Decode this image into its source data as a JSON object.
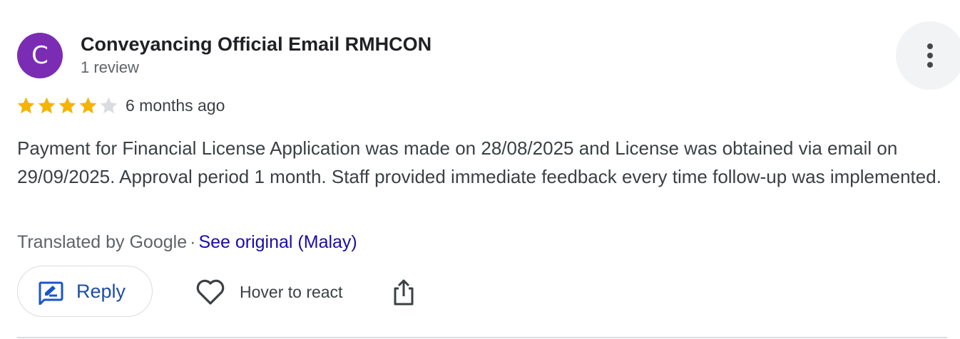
{
  "review": {
    "author": {
      "initial": "C",
      "name": "Conveyancing Official Email RMHCON",
      "review_count": "1 review",
      "avatar_color": "#7b2cb4"
    },
    "rating": 4,
    "rating_max": 5,
    "date": "6 months ago",
    "text": "Payment for Financial License Application was made on 28/08/2025 and License was obtained via email on 29/09/2025. Approval period 1 month. Staff provided immediate feedback every time follow-up was implemented.",
    "translation": {
      "note": "Translated by Google",
      "separator": "·",
      "see_original_label": "See original (Malay)"
    },
    "actions": {
      "reply_label": "Reply",
      "react_label": "Hover to react"
    }
  },
  "colors": {
    "star_filled": "#f4b400",
    "star_empty": "#dadce0",
    "link": "#1a0dab",
    "accent": "#1a73e8"
  },
  "icons": {
    "more": "more-vert-icon",
    "reply": "reply-edit-icon",
    "react": "heart-outline-icon",
    "share": "share-icon",
    "star": "star-icon"
  }
}
